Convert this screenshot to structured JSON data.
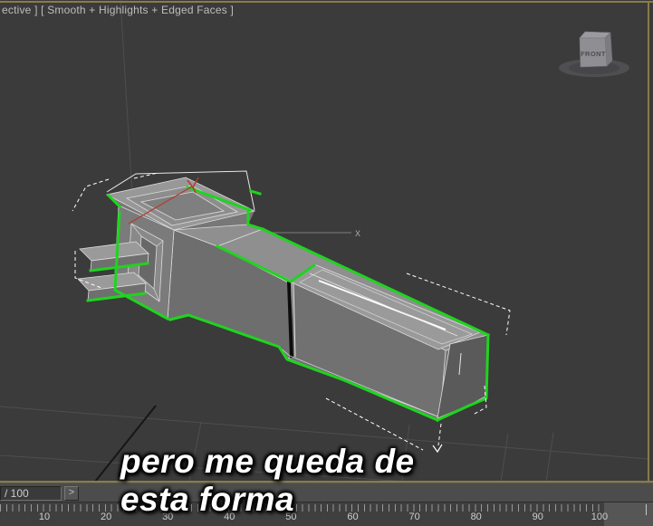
{
  "viewport": {
    "label": "ective ] [ Smooth + Highlights + Edged Faces ]",
    "axis_label_x": "x",
    "viewcube_front_label": "FRONT",
    "caption": {
      "line1": "pero me queda de",
      "line2": "esta forma"
    }
  },
  "timeline": {
    "time_display": "/ 100",
    "next_frame_button": ">",
    "ruler_labels": [
      "10",
      "20",
      "30",
      "40",
      "50",
      "60",
      "70",
      "80",
      "90",
      "100"
    ]
  },
  "colors": {
    "background": "#3b3b3b",
    "selection_green": "#1fd41f",
    "viewport_border": "#897c46",
    "gizmo_red": "#b23b2e"
  }
}
